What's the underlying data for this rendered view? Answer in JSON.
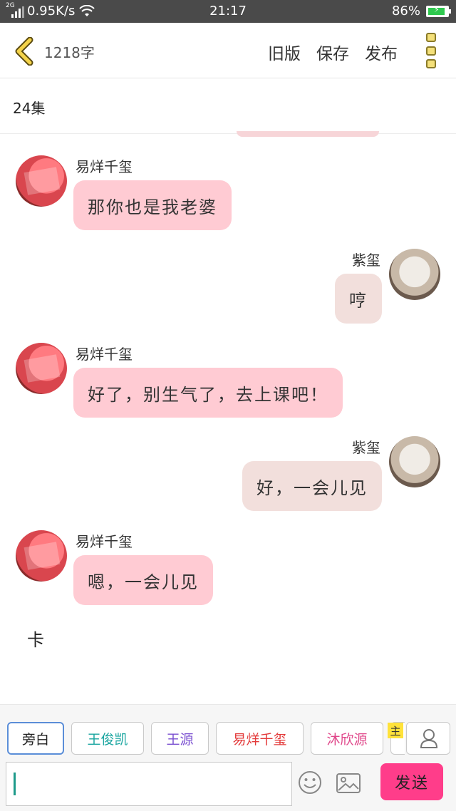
{
  "status_bar": {
    "network": "2G",
    "speed": "0.95K/s",
    "time": "21:17",
    "battery": "86%"
  },
  "header": {
    "word_count": "1218字",
    "actions": [
      "旧版",
      "保存",
      "发布"
    ]
  },
  "episode_title": "24集",
  "messages": [
    {
      "side": "left",
      "name": "易烊千玺",
      "text": "那你也是我老婆"
    },
    {
      "side": "right",
      "name": "紫玺",
      "text": "哼"
    },
    {
      "side": "left",
      "name": "易烊千玺",
      "text": "好了，别生气了，去上课吧！"
    },
    {
      "side": "right",
      "name": "紫玺",
      "text": "好，一会儿见"
    },
    {
      "side": "left",
      "name": "易烊千玺",
      "text": "嗯，一会儿见"
    }
  ],
  "narration": "卡",
  "roles": [
    {
      "label": "旁白",
      "color": "#333333"
    },
    {
      "label": "王俊凯",
      "color": "#1aa5a0"
    },
    {
      "label": "王源",
      "color": "#7a4fd0"
    },
    {
      "label": "易烊千玺",
      "color": "#e33a3a"
    },
    {
      "label": "沐欣源",
      "color": "#e0478a"
    }
  ],
  "main_badge": "主",
  "send_label": "发送",
  "colors": {
    "left_bubble": "#ffcbd3",
    "right_bubble": "#f2dfdc",
    "send_button": "#ff3d8a",
    "back_icon": "#f4d34a"
  }
}
